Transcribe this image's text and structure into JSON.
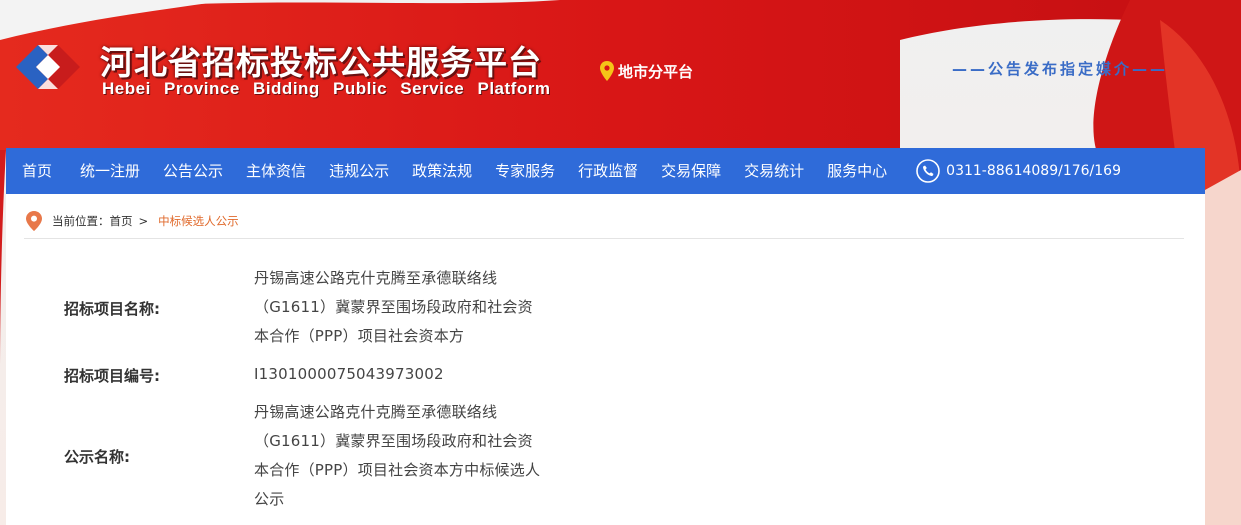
{
  "header": {
    "title": "河北省招标投标公共服务平台",
    "subtitle": "Hebei Province Bidding Public Service Platform",
    "city_platform": "地市分平台",
    "media_note": "——公告发布指定媒介——"
  },
  "nav": {
    "items": [
      "首页",
      "统一注册",
      "公告公示",
      "主体资信",
      "违规公示",
      "政策法规",
      "专家服务",
      "行政监督",
      "交易保障",
      "交易统计",
      "服务中心"
    ],
    "phone": "0311-88614089/176/169"
  },
  "breadcrumb": {
    "prefix": "当前位置：",
    "home": "首页",
    "separator": ">",
    "current": "中标候选人公示"
  },
  "details": {
    "project_name_label": "招标项目名称:",
    "project_name": "丹锡高速公路克什克腾至承德联络线（G1611）冀蒙界至围场段政府和社会资本合作（PPP）项目社会资本方",
    "project_code_label": "招标项目编号:",
    "project_code": "I1301000075043973002",
    "notice_name_label": "公示名称:",
    "notice_name": "丹锡高速公路克什克腾至承德联络线（G1611）冀蒙界至围场段政府和社会资本合作（PPP）项目社会资本方中标候选人公示"
  },
  "colors": {
    "nav_bg": "#2f6bd9",
    "header_red": "#d91e1e",
    "breadcrumb_current": "#e06a2c"
  }
}
